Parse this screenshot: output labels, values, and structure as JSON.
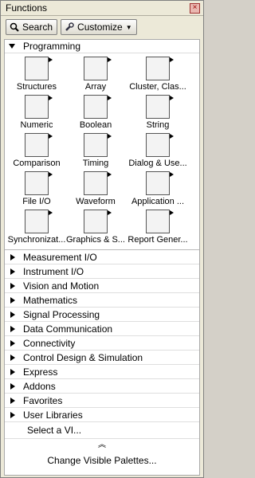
{
  "window": {
    "title": "Functions"
  },
  "toolbar": {
    "search_label": "Search",
    "customize_label": "Customize"
  },
  "programming": {
    "label": "Programming",
    "items": [
      {
        "label": "Structures",
        "icon": "structures-icon"
      },
      {
        "label": "Array",
        "icon": "array-icon"
      },
      {
        "label": "Cluster, Clas...",
        "icon": "cluster-icon"
      },
      {
        "label": "Numeric",
        "icon": "numeric-icon"
      },
      {
        "label": "Boolean",
        "icon": "boolean-icon"
      },
      {
        "label": "String",
        "icon": "string-icon"
      },
      {
        "label": "Comparison",
        "icon": "comparison-icon"
      },
      {
        "label": "Timing",
        "icon": "timing-icon"
      },
      {
        "label": "Dialog & Use...",
        "icon": "dialog-icon"
      },
      {
        "label": "File I/O",
        "icon": "file-io-icon"
      },
      {
        "label": "Waveform",
        "icon": "waveform-icon"
      },
      {
        "label": "Application ...",
        "icon": "application-icon"
      },
      {
        "label": "Synchronizat...",
        "icon": "synchronization-icon"
      },
      {
        "label": "Graphics & S...",
        "icon": "graphics-icon"
      },
      {
        "label": "Report Gener...",
        "icon": "report-icon"
      }
    ]
  },
  "categories": [
    "Measurement I/O",
    "Instrument I/O",
    "Vision and Motion",
    "Mathematics",
    "Signal Processing",
    "Data Communication",
    "Connectivity",
    "Control Design & Simulation",
    "Express",
    "Addons",
    "Favorites",
    "User Libraries"
  ],
  "footer": {
    "select_vi": "Select a VI...",
    "change_palettes": "Change Visible Palettes..."
  }
}
